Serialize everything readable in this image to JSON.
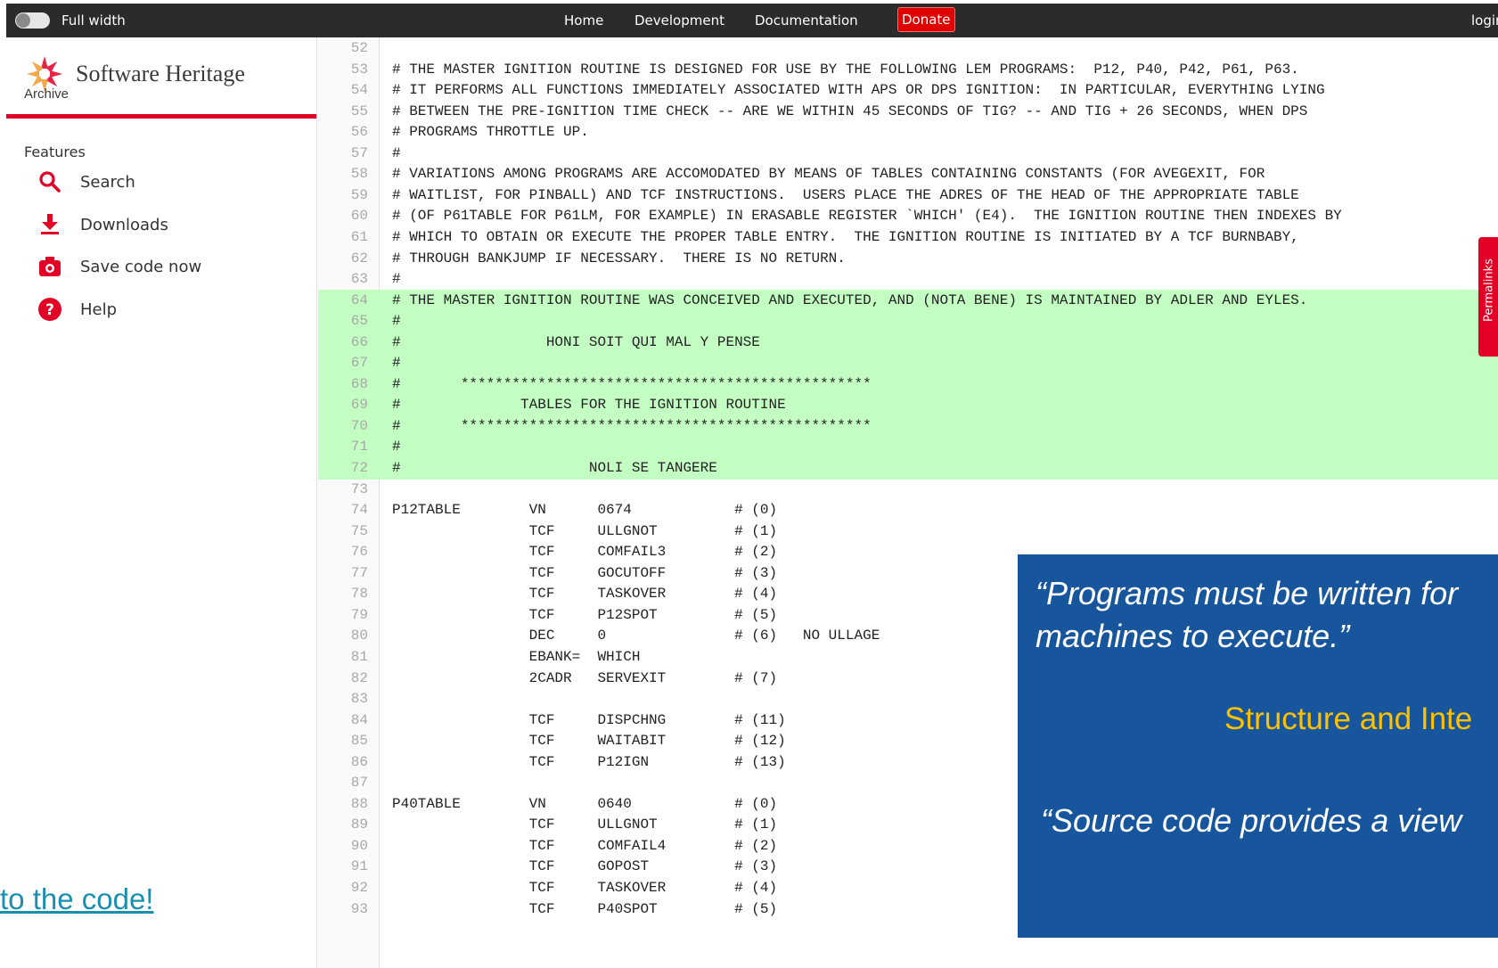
{
  "topbar": {
    "toggle_label": "Full width",
    "nav": [
      "Home",
      "Development",
      "Documentation"
    ],
    "donate": "Donate",
    "login": "login"
  },
  "sidebar": {
    "brand_title": "Software Heritage",
    "brand_sub": "Archive",
    "section": "Features",
    "items": [
      {
        "label": "Search",
        "icon": "search-icon"
      },
      {
        "label": "Downloads",
        "icon": "download-icon"
      },
      {
        "label": "Save code now",
        "icon": "camera-icon"
      },
      {
        "label": "Help",
        "icon": "help-icon"
      }
    ]
  },
  "slide_link": "to the code!",
  "code": {
    "highlight_range": [
      64,
      72
    ],
    "lines": [
      {
        "n": "52",
        "t": ""
      },
      {
        "n": "53",
        "t": "# THE MASTER IGNITION ROUTINE IS DESIGNED FOR USE BY THE FOLLOWING LEM PROGRAMS:  P12, P40, P42, P61, P63."
      },
      {
        "n": "54",
        "t": "# IT PERFORMS ALL FUNCTIONS IMMEDIATELY ASSOCIATED WITH APS OR DPS IGNITION:  IN PARTICULAR, EVERYTHING LYING"
      },
      {
        "n": "55",
        "t": "# BETWEEN THE PRE-IGNITION TIME CHECK -- ARE WE WITHIN 45 SECONDS OF TIG? -- AND TIG + 26 SECONDS, WHEN DPS"
      },
      {
        "n": "56",
        "t": "# PROGRAMS THROTTLE UP."
      },
      {
        "n": "57",
        "t": "#"
      },
      {
        "n": "58",
        "t": "# VARIATIONS AMONG PROGRAMS ARE ACCOMODATED BY MEANS OF TABLES CONTAINING CONSTANTS (FOR AVEGEXIT, FOR"
      },
      {
        "n": "59",
        "t": "# WAITLIST, FOR PINBALL) AND TCF INSTRUCTIONS.  USERS PLACE THE ADRES OF THE HEAD OF THE APPROPRIATE TABLE"
      },
      {
        "n": "60",
        "t": "# (OF P61TABLE FOR P61LM, FOR EXAMPLE) IN ERASABLE REGISTER `WHICH' (E4).  THE IGNITION ROUTINE THEN INDEXES BY"
      },
      {
        "n": "61",
        "t": "# WHICH TO OBTAIN OR EXECUTE THE PROPER TABLE ENTRY.  THE IGNITION ROUTINE IS INITIATED BY A TCF BURNBABY,"
      },
      {
        "n": "62",
        "t": "# THROUGH BANKJUMP IF NECESSARY.  THERE IS NO RETURN."
      },
      {
        "n": "63",
        "t": "#"
      },
      {
        "n": "64",
        "t": "# THE MASTER IGNITION ROUTINE WAS CONCEIVED AND EXECUTED, AND (NOTA BENE) IS MAINTAINED BY ADLER AND EYLES."
      },
      {
        "n": "65",
        "t": "#"
      },
      {
        "n": "66",
        "t": "#                 HONI SOIT QUI MAL Y PENSE"
      },
      {
        "n": "67",
        "t": "#"
      },
      {
        "n": "68",
        "t": "#       ************************************************"
      },
      {
        "n": "69",
        "t": "#              TABLES FOR THE IGNITION ROUTINE"
      },
      {
        "n": "70",
        "t": "#       ************************************************"
      },
      {
        "n": "71",
        "t": "#"
      },
      {
        "n": "72",
        "t": "#                      NOLI SE TANGERE"
      },
      {
        "n": "73",
        "t": ""
      },
      {
        "n": "74",
        "t": "P12TABLE        VN      0674            # (0)"
      },
      {
        "n": "75",
        "t": "                TCF     ULLGNOT         # (1)"
      },
      {
        "n": "76",
        "t": "                TCF     COMFAIL3        # (2)"
      },
      {
        "n": "77",
        "t": "                TCF     GOCUTOFF        # (3)"
      },
      {
        "n": "78",
        "t": "                TCF     TASKOVER        # (4)"
      },
      {
        "n": "79",
        "t": "                TCF     P12SPOT         # (5)"
      },
      {
        "n": "80",
        "t": "                DEC     0               # (6)   NO ULLAGE"
      },
      {
        "n": "81",
        "t": "                EBANK=  WHICH"
      },
      {
        "n": "82",
        "t": "                2CADR   SERVEXIT        # (7)"
      },
      {
        "n": "83",
        "t": ""
      },
      {
        "n": "84",
        "t": "                TCF     DISPCHNG        # (11)"
      },
      {
        "n": "85",
        "t": "                TCF     WAITABIT        # (12)"
      },
      {
        "n": "86",
        "t": "                TCF     P12IGN          # (13)"
      },
      {
        "n": "87",
        "t": ""
      },
      {
        "n": "88",
        "t": "P40TABLE        VN      0640            # (0)"
      },
      {
        "n": "89",
        "t": "                TCF     ULLGNOT         # (1)"
      },
      {
        "n": "90",
        "t": "                TCF     COMFAIL4        # (2)"
      },
      {
        "n": "91",
        "t": "                TCF     GOPOST          # (3)"
      },
      {
        "n": "92",
        "t": "                TCF     TASKOVER        # (4)"
      },
      {
        "n": "93",
        "t": "                TCF     P40SPOT         # (5)"
      }
    ]
  },
  "permalinks": "Permalinks",
  "quote": {
    "line1": "“Programs must be written for",
    "line2": "machines to execute.”",
    "source": "Structure and Inte",
    "line3": "“Source code provides a view"
  },
  "colors": {
    "topbar": "#2b2b2b",
    "brand_red": "#e20026",
    "highlight": "#c3fec3",
    "quote_bg": "#17569c",
    "quote_source": "#ffc000",
    "link": "#1a8fb0"
  }
}
